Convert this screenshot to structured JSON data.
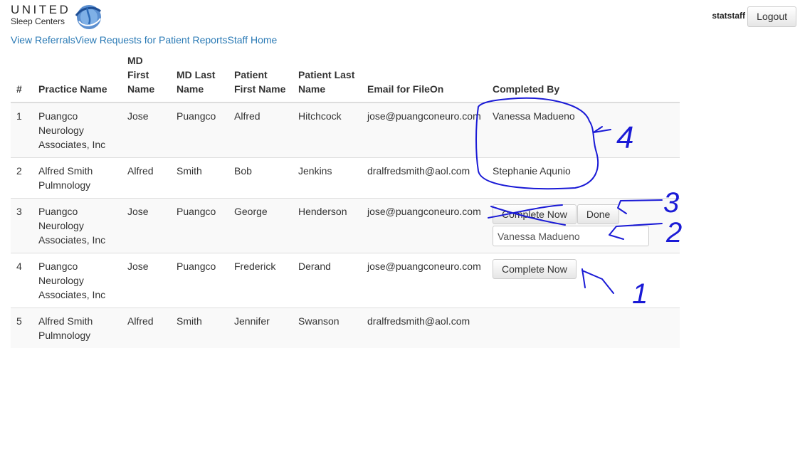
{
  "brand": {
    "line1": "UNITED",
    "line2": "Sleep Centers"
  },
  "header": {
    "username": "statstaff",
    "logout_label": "Logout"
  },
  "nav": {
    "links": [
      "View Referrals",
      "View Requests for Patient Reports",
      "Staff Home"
    ]
  },
  "table": {
    "headers": [
      "#",
      "Practice Name",
      "MD First Name",
      "MD Last Name",
      "Patient First Name",
      "Patient Last Name",
      "Email for FileOn",
      "Completed By"
    ],
    "rows": [
      {
        "num": "1",
        "practice": "Puangco Neurology Associates, Inc",
        "md_first": "Jose",
        "md_last": "Puangco",
        "patient_first": "Alfred",
        "patient_last": "Hitchcock",
        "email": "jose@puangconeuro.com",
        "completed_by": "Vanessa Madueno"
      },
      {
        "num": "2",
        "practice": "Alfred Smith Pulmnology",
        "md_first": "Alfred",
        "md_last": "Smith",
        "patient_first": "Bob",
        "patient_last": "Jenkins",
        "email": "dralfredsmith@aol.com",
        "completed_by": "Stephanie Aqunio"
      },
      {
        "num": "3",
        "practice": "Puangco Neurology Associates, Inc",
        "md_first": "Jose",
        "md_last": "Puangco",
        "patient_first": "George",
        "patient_last": "Henderson",
        "email": "jose@puangconeuro.com",
        "complete_now_label": "Complete Now",
        "done_label": "Done",
        "input_value": "Vanessa Madueno"
      },
      {
        "num": "4",
        "practice": "Puangco Neurology Associates, Inc",
        "md_first": "Jose",
        "md_last": "Puangco",
        "patient_first": "Frederick",
        "patient_last": "Derand",
        "email": "jose@puangconeuro.com",
        "complete_now_label": "Complete Now"
      },
      {
        "num": "5",
        "practice": "Alfred Smith Pulmnology",
        "md_first": "Alfred",
        "md_last": "Smith",
        "patient_first": "Jennifer",
        "patient_last": "Swanson",
        "email": "dralfredsmith@aol.com"
      }
    ]
  },
  "annotations": {
    "labels": [
      "4",
      "3",
      "2",
      "1"
    ],
    "ink_color": "#1a1ad6"
  },
  "colors": {
    "link": "#2a7ab5",
    "stripe": "#f9f9f9",
    "border": "#dddddd"
  }
}
